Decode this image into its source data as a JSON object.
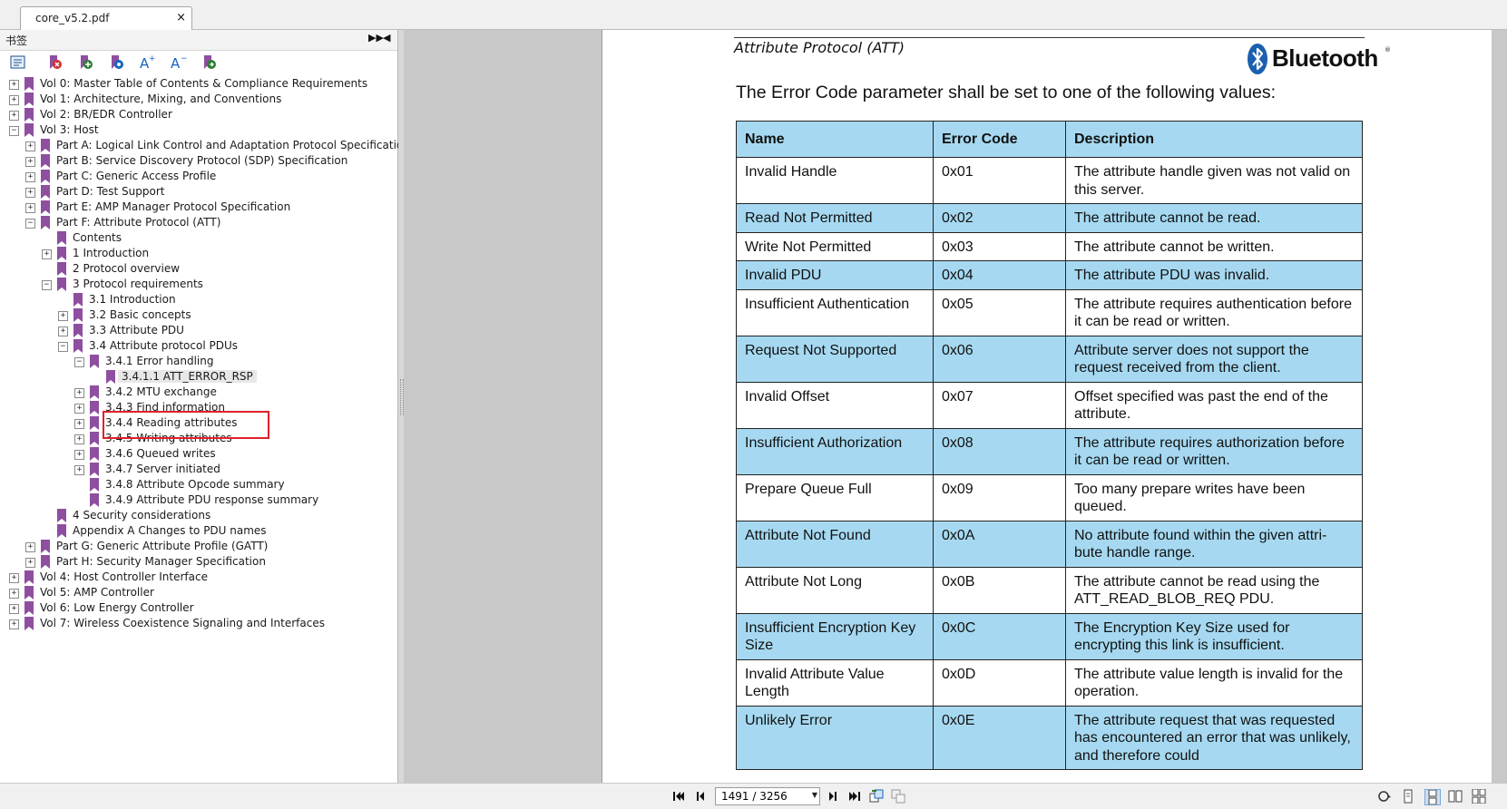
{
  "tab": {
    "title": "core_v5.2.pdf",
    "close_glyph": "×"
  },
  "sidebar": {
    "title": "书签",
    "toolbar": [
      {
        "icon": "bookmark-options-icon",
        "color": "#1b4f8c"
      },
      {
        "icon": "delete-bookmark-icon",
        "color": "#d32f2f"
      },
      {
        "icon": "new-bookmark-icon",
        "color": "#2e7d32"
      },
      {
        "icon": "bookmark-properties-icon",
        "color": "#1565c0"
      },
      {
        "icon": "increase-font-icon",
        "color": "#1565c0"
      },
      {
        "icon": "decrease-font-icon",
        "color": "#1565c0"
      },
      {
        "icon": "go-to-bookmark-icon",
        "color": "#2e7d32"
      }
    ],
    "tree": [
      {
        "label": "Vol 0: Master Table of Contents & Compliance Requirements",
        "level": 0,
        "toggle": "+"
      },
      {
        "label": "Vol 1: Architecture, Mixing, and Conventions",
        "level": 0,
        "toggle": "+"
      },
      {
        "label": "Vol 2: BR/EDR Controller",
        "level": 0,
        "toggle": "+"
      },
      {
        "label": "Vol 3: Host",
        "level": 0,
        "toggle": "−"
      },
      {
        "label": "Part A: Logical Link Control and Adaptation Protocol Specification",
        "level": 1,
        "toggle": "+"
      },
      {
        "label": "Part B: Service Discovery Protocol (SDP) Specification",
        "level": 1,
        "toggle": "+"
      },
      {
        "label": "Part C: Generic Access Profile",
        "level": 1,
        "toggle": "+"
      },
      {
        "label": "Part D: Test Support",
        "level": 1,
        "toggle": "+"
      },
      {
        "label": "Part E: AMP Manager Protocol Specification",
        "level": 1,
        "toggle": "+"
      },
      {
        "label": "Part F: Attribute Protocol (ATT)",
        "level": 1,
        "toggle": "−"
      },
      {
        "label": "Contents",
        "level": 2,
        "toggle": ""
      },
      {
        "label": "1 Introduction",
        "level": 2,
        "toggle": "+"
      },
      {
        "label": "2 Protocol overview",
        "level": 2,
        "toggle": ""
      },
      {
        "label": "3 Protocol requirements",
        "level": 2,
        "toggle": "−"
      },
      {
        "label": "3.1 Introduction",
        "level": 3,
        "toggle": ""
      },
      {
        "label": "3.2 Basic concepts",
        "level": 3,
        "toggle": "+"
      },
      {
        "label": "3.3 Attribute PDU",
        "level": 3,
        "toggle": "+"
      },
      {
        "label": "3.4 Attribute protocol PDUs",
        "level": 3,
        "toggle": "−"
      },
      {
        "label": "3.4.1 Error handling",
        "level": 4,
        "toggle": "−"
      },
      {
        "label": "3.4.1.1 ATT_ERROR_RSP",
        "level": 5,
        "toggle": "",
        "selected": true
      },
      {
        "label": "3.4.2 MTU exchange",
        "level": 4,
        "toggle": "+"
      },
      {
        "label": "3.4.3 Find information",
        "level": 4,
        "toggle": "+"
      },
      {
        "label": "3.4.4 Reading attributes",
        "level": 4,
        "toggle": "+"
      },
      {
        "label": "3.4.5 Writing attributes",
        "level": 4,
        "toggle": "+"
      },
      {
        "label": "3.4.6 Queued writes",
        "level": 4,
        "toggle": "+"
      },
      {
        "label": "3.4.7 Server initiated",
        "level": 4,
        "toggle": "+"
      },
      {
        "label": "3.4.8 Attribute Opcode summary",
        "level": 4,
        "toggle": ""
      },
      {
        "label": "3.4.9 Attribute PDU response summary",
        "level": 4,
        "toggle": ""
      },
      {
        "label": "4 Security considerations",
        "level": 2,
        "toggle": ""
      },
      {
        "label": "Appendix A Changes to PDU names",
        "level": 2,
        "toggle": ""
      },
      {
        "label": "Part G: Generic Attribute Profile (GATT)",
        "level": 1,
        "toggle": "+"
      },
      {
        "label": "Part H: Security Manager Specification",
        "level": 1,
        "toggle": "+"
      },
      {
        "label": "Vol 4: Host Controller Interface",
        "level": 0,
        "toggle": "+"
      },
      {
        "label": "Vol 5: AMP Controller",
        "level": 0,
        "toggle": "+"
      },
      {
        "label": "Vol 6: Low Energy Controller",
        "level": 0,
        "toggle": "+"
      },
      {
        "label": "Vol 7: Wireless Coexistence Signaling and Interfaces",
        "level": 0,
        "toggle": "+"
      }
    ],
    "bookmark_color": "#8e4fa0"
  },
  "document": {
    "section_title": "Attribute Protocol (ATT)",
    "logo_text": "Bluetooth",
    "logo_reg": "®",
    "logo_color": "#1b5fae",
    "intro": "The Error Code parameter shall be set to one of the following values:",
    "table": {
      "headers": [
        "Name",
        "Error Code",
        "Description"
      ],
      "header_color": "#a6d9f1",
      "rows": [
        {
          "name": "Invalid Handle",
          "code": "0x01",
          "desc": "The attribute handle given was not valid on this server.",
          "shade": false
        },
        {
          "name": "Read Not Permitted",
          "code": "0x02",
          "desc": "The attribute cannot be read.",
          "shade": true
        },
        {
          "name": "Write Not Permitted",
          "code": "0x03",
          "desc": "The attribute cannot be written.",
          "shade": false
        },
        {
          "name": "Invalid PDU",
          "code": "0x04",
          "desc": "The attribute PDU was invalid.",
          "shade": true
        },
        {
          "name": "Insufficient Authentication",
          "code": "0x05",
          "desc": "The attribute requires authentication before it can be read or written.",
          "shade": false
        },
        {
          "name": "Request Not Supported",
          "code": "0x06",
          "desc": "Attribute server does not support the request received from the client.",
          "shade": true
        },
        {
          "name": "Invalid Offset",
          "code": "0x07",
          "desc": "Offset specified was past the end of the attribute.",
          "shade": false
        },
        {
          "name": "Insufficient Authorization",
          "code": "0x08",
          "desc": "The attribute requires authorization before it can be read or written.",
          "shade": true
        },
        {
          "name": "Prepare Queue Full",
          "code": "0x09",
          "desc": "Too many prepare writes have been queued.",
          "shade": false
        },
        {
          "name": "Attribute Not Found",
          "code": "0x0A",
          "desc": "No attribute found within the given attri-bute handle range.",
          "shade": true
        },
        {
          "name": "Attribute Not Long",
          "code": "0x0B",
          "desc": "The attribute cannot be read using the ATT_READ_BLOB_REQ PDU.",
          "shade": false
        },
        {
          "name": "Insufficient Encryption Key Size",
          "code": "0x0C",
          "desc": "The Encryption Key Size used for encrypting this link is insufficient.",
          "shade": true
        },
        {
          "name": "Invalid Attribute Value Length",
          "code": "0x0D",
          "desc": "The attribute value length is invalid for the operation.",
          "shade": false
        },
        {
          "name": "Unlikely Error",
          "code": "0x0E",
          "desc": "The attribute request that was requested has encountered an error that was unlikely, and therefore could",
          "shade": true
        }
      ]
    }
  },
  "statusbar": {
    "page_value": "1491 / 3256",
    "nav": [
      {
        "icon": "first-page-icon"
      },
      {
        "icon": "previous-page-icon"
      },
      {
        "icon": "next-page-icon"
      },
      {
        "icon": "last-page-icon"
      },
      {
        "icon": "previous-view-icon"
      },
      {
        "icon": "next-view-icon"
      }
    ],
    "view": [
      {
        "icon": "rotate-view-icon"
      },
      {
        "icon": "single-page-icon"
      },
      {
        "icon": "continuous-page-icon"
      },
      {
        "icon": "facing-pages-icon"
      },
      {
        "icon": "continuous-facing-icon"
      }
    ]
  }
}
